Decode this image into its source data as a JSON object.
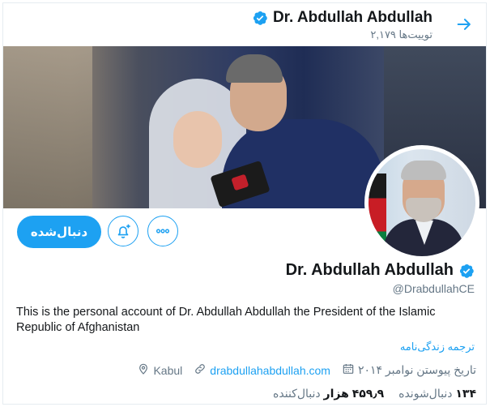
{
  "header": {
    "display_name": "Dr. Abdullah Abdullah",
    "tweet_count": "۲,۱۷۹ توییت‌ها",
    "back_icon": "arrow-right-icon"
  },
  "banner": {
    "icon": "banner-photo"
  },
  "avatar": {
    "icon": "profile-avatar-photo"
  },
  "actions": {
    "follow_label": "دنبال‌شده",
    "notify_icon": "bell-plus-icon",
    "more_icon": "more-dots-icon"
  },
  "profile": {
    "name": "Dr. Abdullah Abdullah",
    "handle": "@DrabdullahCE",
    "bio": "This is the personal account of Dr. Abdullah Abdullah the President of the Islamic Republic of Afghanistan",
    "translate_label": "ترجمه زندگی‌نامه",
    "location": "Kabul",
    "website": "drabdullahabdullah.com",
    "joined": "تاریخ پیوستن نوامبر ۲۰۱۴"
  },
  "stats": {
    "following_count": "۱۳۴",
    "following_label": "دنبال‌شونده",
    "followers_count": "۴۵۹٫۹ هزار",
    "followers_label": "دنبال‌کننده"
  },
  "colors": {
    "accent": "#1da1f2",
    "text": "#14171a",
    "muted": "#657786"
  }
}
